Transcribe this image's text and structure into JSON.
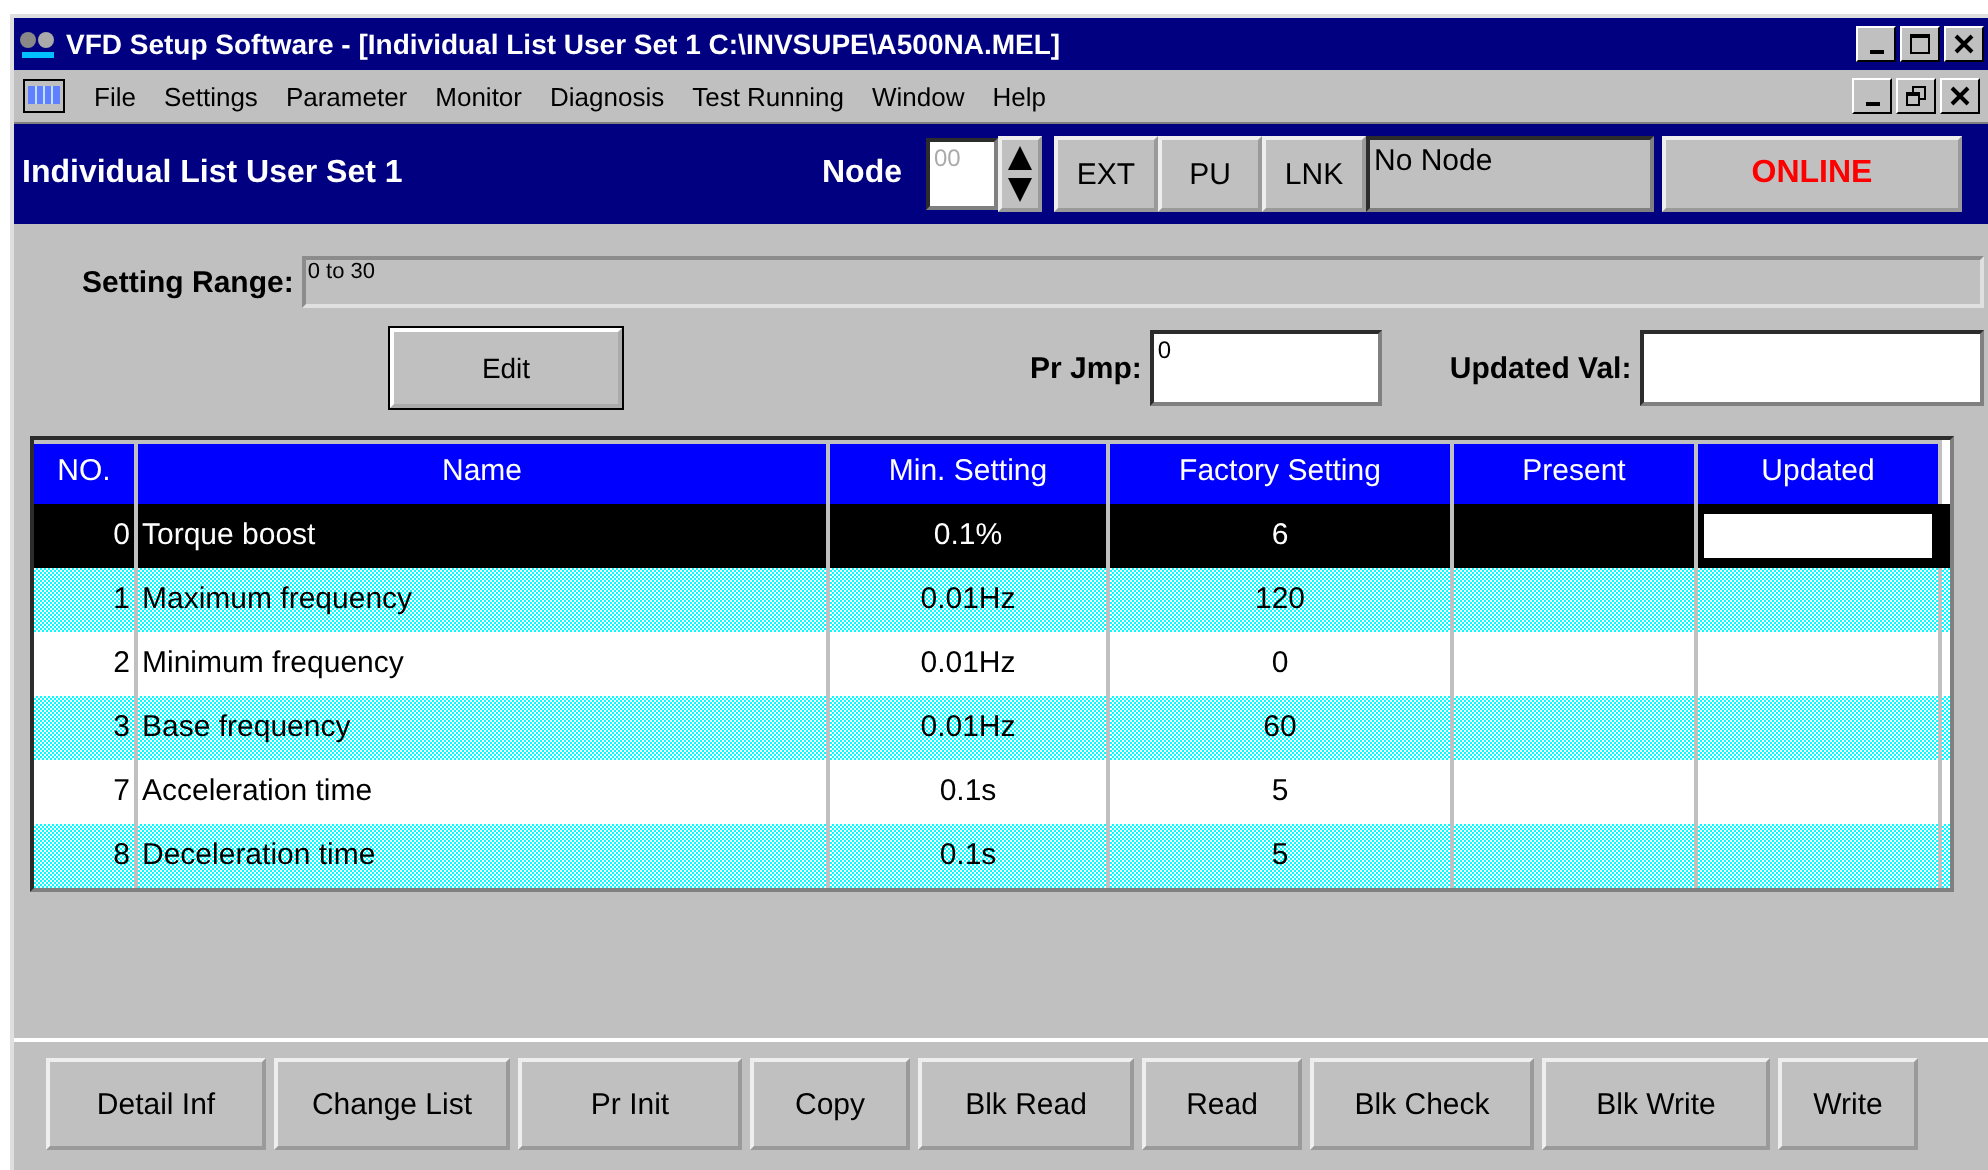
{
  "window": {
    "title": "VFD Setup Software - [Individual List User Set 1 C:\\INVSUPE\\A500NA.MEL]"
  },
  "menu": {
    "items": [
      "File",
      "Settings",
      "Parameter",
      "Monitor",
      "Diagnosis",
      "Test Running",
      "Window",
      "Help"
    ]
  },
  "header": {
    "title": "Individual List User Set 1",
    "node_label": "Node",
    "node_value": "00",
    "mode_buttons": [
      "EXT",
      "PU",
      "LNK"
    ],
    "node_status": "No Node",
    "online_button": "ONLINE"
  },
  "setting_range": {
    "label": "Setting Range:",
    "value": "0 to 30"
  },
  "edit_button": "Edit",
  "pr_jmp": {
    "label": "Pr Jmp:",
    "value": "0"
  },
  "updated_val": {
    "label": "Updated Val:"
  },
  "table": {
    "columns": [
      "NO.",
      "Name",
      "Min. Setting",
      "Factory Setting",
      "Present",
      "Updated"
    ],
    "rows": [
      {
        "no": "0",
        "name": "Torque boost",
        "min": "0.1%",
        "factory": "6",
        "selected": true
      },
      {
        "no": "1",
        "name": "Maximum frequency",
        "min": "0.01Hz",
        "factory": "120",
        "selected": false
      },
      {
        "no": "2",
        "name": "Minimum frequency",
        "min": "0.01Hz",
        "factory": "0",
        "selected": false
      },
      {
        "no": "3",
        "name": "Base frequency",
        "min": "0.01Hz",
        "factory": "60",
        "selected": false
      },
      {
        "no": "7",
        "name": "Acceleration time",
        "min": "0.1s",
        "factory": "5",
        "selected": false
      },
      {
        "no": "8",
        "name": "Deceleration time",
        "min": "0.1s",
        "factory": "5",
        "selected": false
      }
    ]
  },
  "buttons": [
    "Detail Inf",
    "Change List",
    "Pr Init",
    "Copy",
    "Blk Read",
    "Read",
    "Blk Check",
    "Blk Write",
    "Write"
  ]
}
